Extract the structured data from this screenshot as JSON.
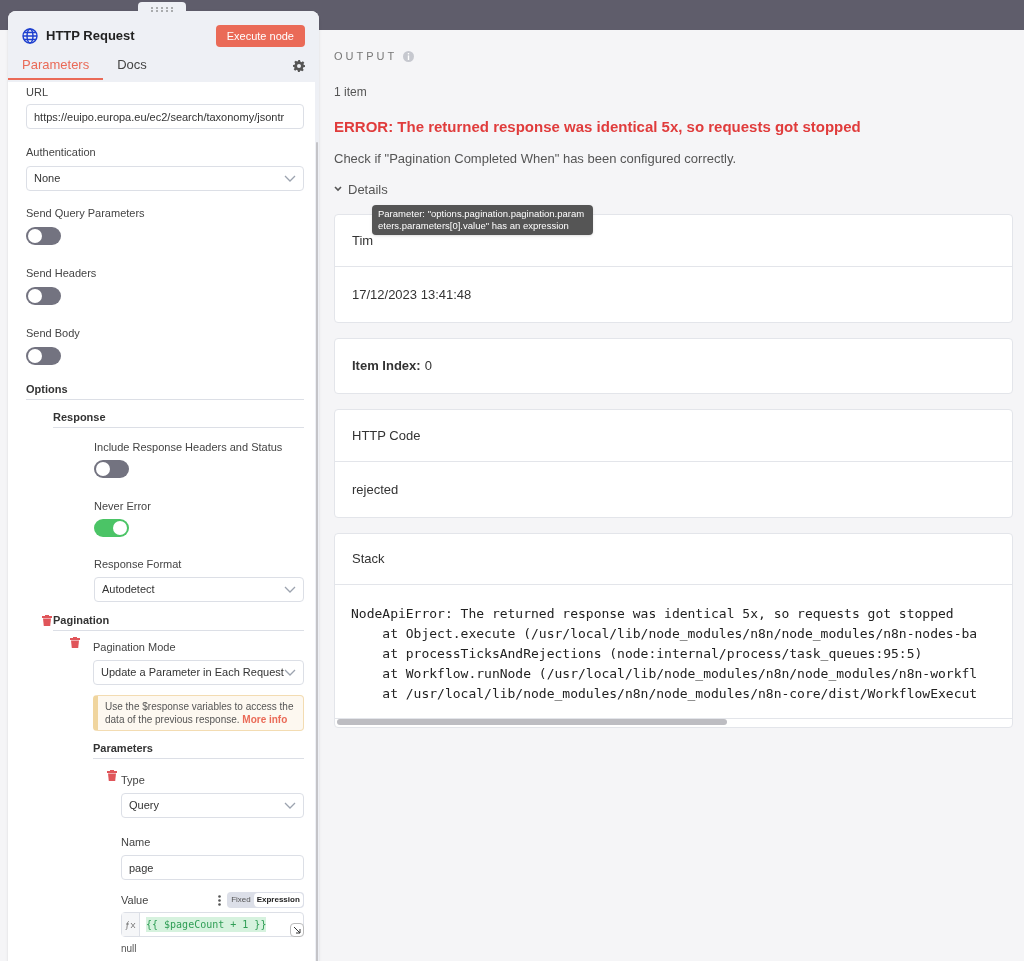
{
  "node": {
    "title": "HTTP Request",
    "execute_button": "Execute node"
  },
  "tabs": [
    {
      "label": "Parameters",
      "selected": true
    },
    {
      "label": "Docs",
      "selected": false
    }
  ],
  "parameters": {
    "url": {
      "label": "URL",
      "value": "https://euipo.europa.eu/ec2/search/taxonomy/jsontr"
    },
    "authentication": {
      "label": "Authentication",
      "value": "None"
    },
    "toggles": [
      {
        "label": "Send Query Parameters",
        "on": false
      },
      {
        "label": "Send Headers",
        "on": false
      },
      {
        "label": "Send Body",
        "on": false
      }
    ],
    "options": {
      "label": "Options",
      "response": {
        "label": "Response",
        "toggles": [
          {
            "label": "Include Response Headers and Status",
            "on": false
          },
          {
            "label": "Never Error",
            "on": true
          }
        ],
        "format": {
          "label": "Response Format",
          "value": "Autodetect"
        }
      },
      "pagination": {
        "label": "Pagination",
        "mode": {
          "label": "Pagination Mode",
          "value": "Update a Parameter in Each Request"
        },
        "notice": "Use the $response variables to access the data of the previous response.",
        "notice_link": "More info",
        "parameters": {
          "label": "Parameters",
          "type": {
            "label": "Type",
            "value": "Query"
          },
          "name": {
            "label": "Name",
            "value": "page"
          },
          "value": {
            "label": "Value",
            "modes": [
              {
                "label": "Fixed",
                "selected": false
              },
              {
                "label": "Expression",
                "selected": true
              }
            ],
            "expression": "{{ $pageCount + 1 }}",
            "result": "null"
          }
        }
      }
    }
  },
  "output": {
    "title": "OUTPUT",
    "count": "1 item",
    "error": "ERROR: The returned response was identical 5x, so requests got stopped",
    "hint": "Check if \"Pagination Completed When\" has been configured correctly.",
    "details_label": "Details",
    "details_expanded": true,
    "cards": [
      {
        "kind": "pair",
        "label": "Tim",
        "value": "17/12/2023 13:41:48"
      },
      {
        "kind": "inline",
        "label": "Item Index:",
        "value": "0"
      },
      {
        "kind": "pair",
        "label": "HTTP Code",
        "value": "rejected"
      },
      {
        "kind": "stack",
        "label": "Stack",
        "lines": [
          "NodeApiError: The returned response was identical 5x, so requests got stopped",
          "    at Object.execute (/usr/local/lib/node_modules/n8n/node_modules/n8n-nodes-ba",
          "    at processTicksAndRejections (node:internal/process/task_queues:95:5)",
          "    at Workflow.runNode (/usr/local/lib/node_modules/n8n/node_modules/n8n-workfl",
          "    at /usr/local/lib/node_modules/n8n/node_modules/n8n-core/dist/WorkflowExecut"
        ]
      }
    ]
  },
  "tooltip": {
    "text": "Parameter: \"options.pagination.pagination.parameters.parameters[0].value\" has an expression"
  }
}
